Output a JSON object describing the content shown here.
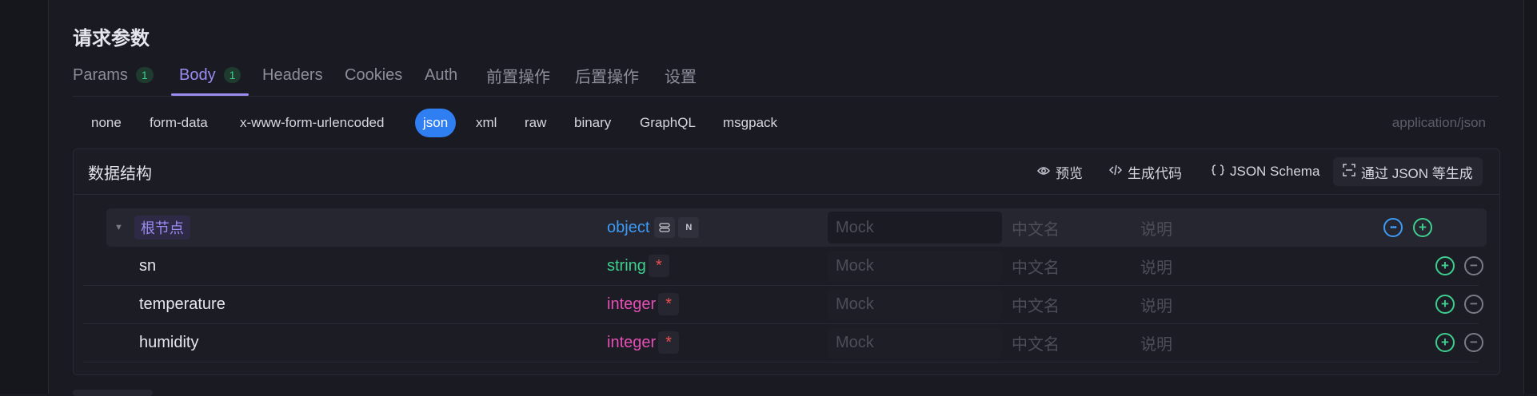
{
  "section": {
    "title": "请求参数"
  },
  "tabs": [
    {
      "label": "Params",
      "badge": "1"
    },
    {
      "label": "Body",
      "badge": "1"
    },
    {
      "label": "Headers"
    },
    {
      "label": "Cookies"
    },
    {
      "label": "Auth"
    },
    {
      "label": "前置操作"
    },
    {
      "label": "后置操作"
    },
    {
      "label": "设置"
    }
  ],
  "body_types": [
    "none",
    "form-data",
    "x-www-form-urlencoded",
    "json",
    "xml",
    "raw",
    "binary",
    "GraphQL",
    "msgpack"
  ],
  "selected_body_type": "json",
  "content_type": "application/json",
  "panel": {
    "title": "数据结构",
    "tools": {
      "preview": "预览",
      "generate_code": "生成代码",
      "json_schema": "JSON Schema",
      "generate_from_json": "通过 JSON 等生成"
    }
  },
  "schema": {
    "root": {
      "name": "根节点",
      "type": "object",
      "mini_button": "N",
      "mock_placeholder": "Mock",
      "cn_placeholder": "中文名",
      "desc_placeholder": "说明"
    },
    "fields": [
      {
        "name": "sn",
        "type": "string",
        "required": "*",
        "mock_placeholder": "Mock",
        "cn_placeholder": "中文名",
        "desc_placeholder": "说明"
      },
      {
        "name": "temperature",
        "type": "integer",
        "required": "*",
        "mock_placeholder": "Mock",
        "cn_placeholder": "中文名",
        "desc_placeholder": "说明"
      },
      {
        "name": "humidity",
        "type": "integer",
        "required": "*",
        "mock_placeholder": "Mock",
        "cn_placeholder": "中文名",
        "desc_placeholder": "说明"
      }
    ]
  },
  "colors": {
    "accent": "#9b8cf2",
    "selected": "#2f7ff2",
    "type_object": "#3d9bf5",
    "type_string": "#3ecf8e",
    "type_integer": "#e64fb5",
    "required": "#f04e4e"
  },
  "icons": {
    "preview": "eye-icon",
    "generate_code": "code-icon",
    "json_schema": "braces-icon",
    "generate_from_json": "scan-icon",
    "expand": "caret-down-icon",
    "root_settings": "settings-icon",
    "more": "more-icon",
    "add": "plus-circle-icon",
    "remove": "minus-circle-icon"
  }
}
